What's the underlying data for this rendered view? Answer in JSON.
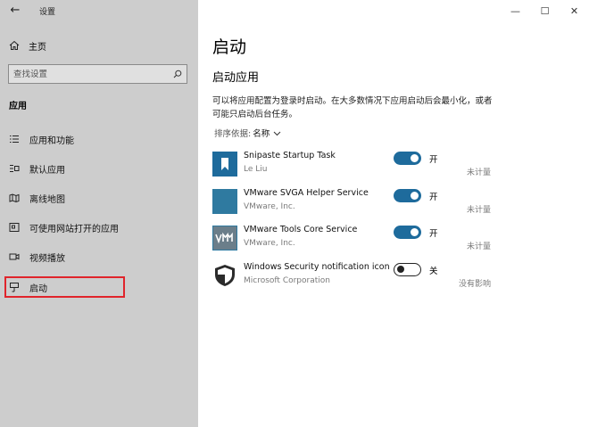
{
  "window": {
    "title": "设置",
    "minimize_icon": "—",
    "maximize_icon": "☐",
    "close_icon": "✕"
  },
  "sidebar": {
    "back_icon": "←",
    "home_label": "主页",
    "search_placeholder": "查找设置",
    "section_heading": "应用",
    "items": [
      {
        "label": "应用和功能",
        "icon": "list-icon"
      },
      {
        "label": "默认应用",
        "icon": "default-apps-icon"
      },
      {
        "label": "离线地图",
        "icon": "map-icon"
      },
      {
        "label": "可使用网站打开的应用",
        "icon": "web-app-icon"
      },
      {
        "label": "视频播放",
        "icon": "video-icon"
      },
      {
        "label": "启动",
        "icon": "startup-icon",
        "selected": true
      }
    ]
  },
  "main": {
    "title": "启动",
    "subtitle": "启动应用",
    "description": "可以将应用配置为登录时启动。在大多数情况下应用启动后会最小化，或者可能只启动后台任务。",
    "sort_label": "排序依据:",
    "sort_value": "名称",
    "apps": [
      {
        "name": "Snipaste Startup Task",
        "publisher": "Le Liu",
        "enabled": true,
        "state_label": "开",
        "impact": "未计量",
        "icon_color": "#1e6b9c"
      },
      {
        "name": "VMware SVGA Helper Service",
        "publisher": "VMware, Inc.",
        "enabled": true,
        "state_label": "开",
        "impact": "未计量",
        "icon_color": "#2f7aa0"
      },
      {
        "name": "VMware Tools Core Service",
        "publisher": "VMware, Inc.",
        "enabled": true,
        "state_label": "开",
        "impact": "未计量",
        "icon_color": "#2f7aa0"
      },
      {
        "name": "Windows Security notification icon",
        "publisher": "Microsoft Corporation",
        "enabled": false,
        "state_label": "关",
        "impact": "没有影响",
        "icon_color": "#2b2b2b"
      }
    ]
  },
  "colors": {
    "accent": "#1e6b9c",
    "sidebar_bg": "#cdcdcd",
    "highlight": "#e0242b"
  }
}
